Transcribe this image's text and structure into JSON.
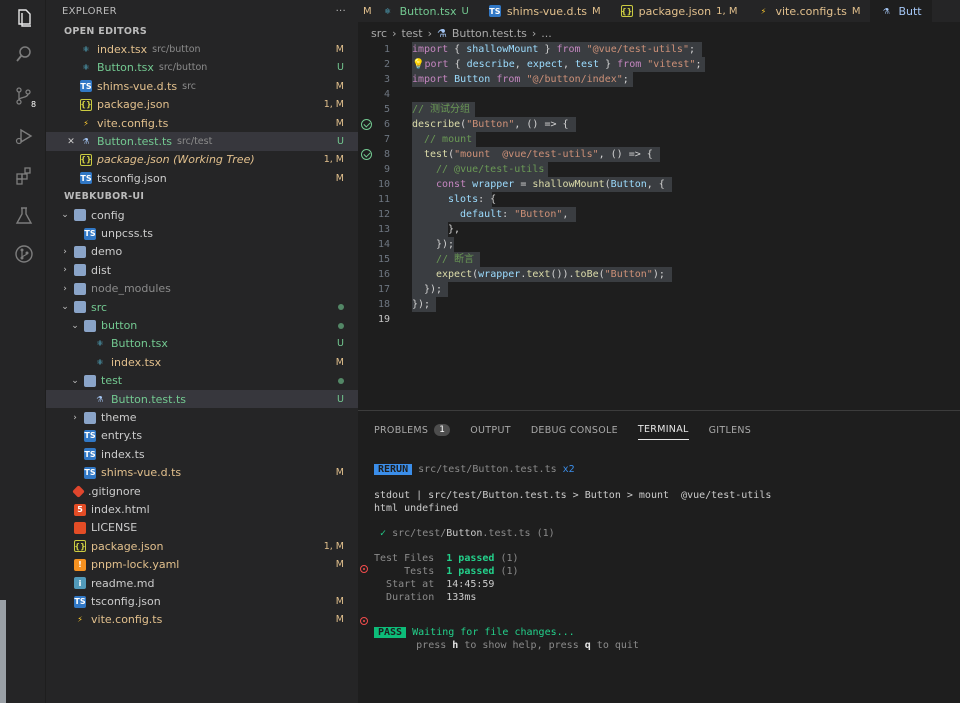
{
  "explorer": {
    "title": "EXPLORER",
    "more": "···",
    "open_editors_label": "OPEN EDITORS",
    "project_label": "WEBKUBOR-UI"
  },
  "open_editors": [
    {
      "name": "index.tsx",
      "hint": "src/button",
      "status": "M",
      "icon": "react-icon"
    },
    {
      "name": "Button.tsx",
      "hint": "src/button",
      "status": "U",
      "icon": "react-icon"
    },
    {
      "name": "shims-vue.d.ts",
      "hint": "src",
      "status": "M",
      "icon": "ts-icon"
    },
    {
      "name": "package.json",
      "hint": "",
      "status": "1, M",
      "icon": "json-icon"
    },
    {
      "name": "vite.config.ts",
      "hint": "",
      "status": "M",
      "icon": "vite-icon"
    },
    {
      "name": "Button.test.ts",
      "hint": "src/test",
      "status": "U",
      "icon": "test-icon",
      "close": "✕"
    },
    {
      "name": "package.json (Working Tree)",
      "hint": "",
      "status": "1, M",
      "icon": "json-icon"
    },
    {
      "name": "tsconfig.json",
      "hint": "",
      "status": "M",
      "icon": "ts-icon"
    }
  ],
  "tree": [
    {
      "name": "config",
      "depth": 1,
      "chev": "⌄",
      "icon": "folder-icon",
      "status": ""
    },
    {
      "name": "unpcss.ts",
      "depth": 2,
      "chev": "",
      "icon": "ts-icon",
      "status": ""
    },
    {
      "name": "demo",
      "depth": 1,
      "chev": "›",
      "icon": "folder-icon",
      "status": ""
    },
    {
      "name": "dist",
      "depth": 1,
      "chev": "›",
      "icon": "folder-icon",
      "status": ""
    },
    {
      "name": "node_modules",
      "depth": 1,
      "chev": "›",
      "icon": "folder-icon",
      "status": ""
    },
    {
      "name": "src",
      "depth": 1,
      "chev": "⌄",
      "icon": "folder-icon",
      "status": "dot"
    },
    {
      "name": "button",
      "depth": 2,
      "chev": "⌄",
      "icon": "folder-icon",
      "status": "dot"
    },
    {
      "name": "Button.tsx",
      "depth": 3,
      "chev": "",
      "icon": "react-icon",
      "status": "U"
    },
    {
      "name": "index.tsx",
      "depth": 3,
      "chev": "",
      "icon": "react-icon",
      "status": "M"
    },
    {
      "name": "test",
      "depth": 2,
      "chev": "⌄",
      "icon": "folder-icon",
      "status": "dot"
    },
    {
      "name": "Button.test.ts",
      "depth": 3,
      "chev": "",
      "icon": "test-icon",
      "status": "U"
    },
    {
      "name": "theme",
      "depth": 2,
      "chev": "›",
      "icon": "folder-icon",
      "status": ""
    },
    {
      "name": "entry.ts",
      "depth": 2,
      "chev": "",
      "icon": "ts-icon",
      "status": ""
    },
    {
      "name": "index.ts",
      "depth": 2,
      "chev": "",
      "icon": "ts-icon",
      "status": ""
    },
    {
      "name": "shims-vue.d.ts",
      "depth": 2,
      "chev": "",
      "icon": "ts-icon",
      "status": "M"
    },
    {
      "name": ".gitignore",
      "depth": 1,
      "chev": "",
      "icon": "git-icon",
      "status": ""
    },
    {
      "name": "index.html",
      "depth": 1,
      "chev": "",
      "icon": "html-icon",
      "status": ""
    },
    {
      "name": "LICENSE",
      "depth": 1,
      "chev": "",
      "icon": "license-icon",
      "status": ""
    },
    {
      "name": "package.json",
      "depth": 1,
      "chev": "",
      "icon": "json-icon",
      "status": "1, M"
    },
    {
      "name": "pnpm-lock.yaml",
      "depth": 1,
      "chev": "",
      "icon": "yaml-icon",
      "status": "M"
    },
    {
      "name": "readme.md",
      "depth": 1,
      "chev": "",
      "icon": "info-icon",
      "status": ""
    },
    {
      "name": "tsconfig.json",
      "depth": 1,
      "chev": "",
      "icon": "ts-icon",
      "status": "M"
    },
    {
      "name": "vite.config.ts",
      "depth": 1,
      "chev": "",
      "icon": "vite-icon",
      "status": "M"
    }
  ],
  "activity_badge": "8",
  "tabs": [
    {
      "name": "",
      "status": "M",
      "icon": ""
    },
    {
      "name": "Button.tsx",
      "status": "U",
      "icon": "react-icon"
    },
    {
      "name": "shims-vue.d.ts",
      "status": "M",
      "icon": "ts-icon"
    },
    {
      "name": "package.json",
      "status": "1, M",
      "icon": "json-icon"
    },
    {
      "name": "vite.config.ts",
      "status": "M",
      "icon": "vite-icon"
    },
    {
      "name": "Butt",
      "status": "",
      "icon": "test-icon"
    }
  ],
  "breadcrumb": [
    "src",
    "›",
    "test",
    "›",
    "Button.test.ts",
    "›",
    "..."
  ],
  "code_lines": [
    "1",
    "2",
    "3",
    "4",
    "5",
    "6",
    "7",
    "8",
    "9",
    "10",
    "11",
    "12",
    "13",
    "14",
    "15",
    "16",
    "17",
    "18",
    "19"
  ],
  "code": {
    "l1": [
      "import",
      " { ",
      "shallowMount",
      " } ",
      "from",
      " ",
      "\"@vue/test-utils\"",
      ";"
    ],
    "l2": [
      "port",
      " { ",
      "describe",
      ", ",
      "expect",
      ", ",
      "test",
      " } ",
      "from",
      " ",
      "\"vitest\"",
      ";"
    ],
    "l3": [
      "import",
      " ",
      "Button",
      " ",
      "from",
      " ",
      "\"@/button/index\"",
      ";"
    ],
    "l5": "// 测试分组",
    "l6": [
      "describe",
      "(",
      "\"Button\"",
      ", () => {"
    ],
    "l7": "// mount",
    "l8": [
      "test",
      "(",
      "\"mount  @vue/test-utils\"",
      ", () => {"
    ],
    "l9": "// @vue/test-utils",
    "l10": [
      "const",
      " ",
      "wrapper",
      " = ",
      "shallowMount",
      "(",
      "Button",
      ", {"
    ],
    "l11": [
      "slots",
      ": {"
    ],
    "l12": [
      "default",
      ": ",
      "\"Button\"",
      ","
    ],
    "l13": "},",
    "l14": "});",
    "l15": "// 断言",
    "l16": [
      "expect",
      "(",
      "wrapper",
      ".",
      "text",
      "()).",
      "toBe",
      "(",
      "\"Button\"",
      ");"
    ],
    "l17": "});",
    "l18": "});"
  },
  "panel": {
    "tabs": [
      "PROBLEMS",
      "OUTPUT",
      "DEBUG CONSOLE",
      "TERMINAL",
      "GITLENS"
    ],
    "problems_count": "1"
  },
  "terminal": {
    "rerun_tag": "RERUN",
    "rerun_path": "src/test/Button.test.ts",
    "rerun_count": "x2",
    "stdout": "stdout | src/test/Button.test.ts > Button > mount  @vue/test-utils",
    "stdout2": "html undefined",
    "check": "✓",
    "file_dir": "src/test/",
    "file_name": "Button",
    "file_ext": ".test.ts",
    "file_count": "(1)",
    "files_label": "Test Files",
    "files_value": "1 passed",
    "files_count": "(1)",
    "tests_label": "Tests",
    "tests_value": "1 passed",
    "tests_count": "(1)",
    "start_label": "Start at",
    "start_value": "14:45:59",
    "duration_label": "Duration",
    "duration_value": "133ms",
    "pass_tag": "PASS",
    "waiting": "Waiting for file changes...",
    "help_1": "press ",
    "help_h": "h",
    "help_2": " to show help, press ",
    "help_q": "q",
    "help_3": " to quit"
  },
  "colors": {
    "modified": "#e2c08d",
    "untracked": "#73c991",
    "accent": "#3b8eea",
    "pass": "#0dbc79"
  }
}
